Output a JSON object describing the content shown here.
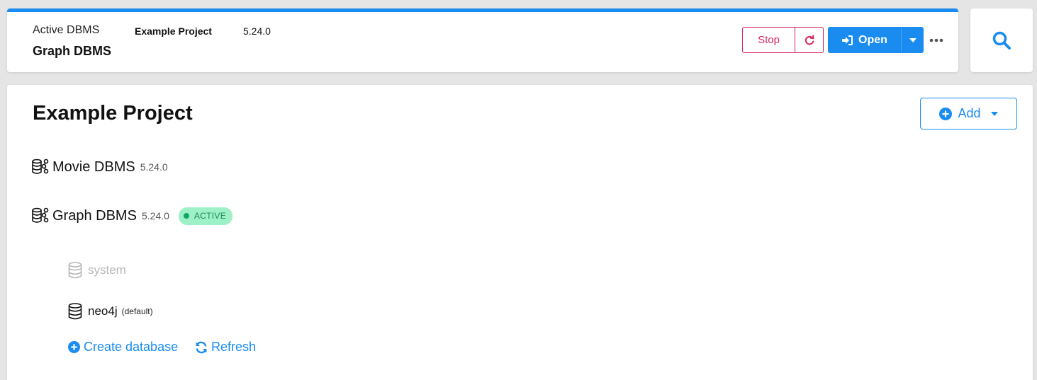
{
  "header": {
    "active_label": "Active DBMS",
    "active_name": "Graph DBMS",
    "project_name": "Example Project",
    "version": "5.24.0",
    "stop_label": "Stop",
    "open_label": "Open"
  },
  "main": {
    "title": "Example Project",
    "add_label": "Add",
    "dbms": [
      {
        "name": "Movie DBMS",
        "version": "5.24.0"
      },
      {
        "name": "Graph DBMS",
        "version": "5.24.0",
        "status": "ACTIVE"
      }
    ],
    "databases": [
      {
        "name": "system",
        "enabled": false
      },
      {
        "name": "neo4j",
        "suffix": "(default)",
        "enabled": true
      }
    ],
    "create_label": "Create database",
    "refresh_label": "Refresh"
  },
  "colors": {
    "accent": "#1a8cf0",
    "stop": "#d6285c",
    "active_badge_bg": "#9ef0c6",
    "active_badge_text": "#1c8a55"
  },
  "icons": [
    "restart-icon",
    "sign-in-icon",
    "caret-down-icon",
    "more-icon",
    "search-icon",
    "plus-circle-icon",
    "dbms-icon",
    "database-icon",
    "refresh-icon"
  ]
}
